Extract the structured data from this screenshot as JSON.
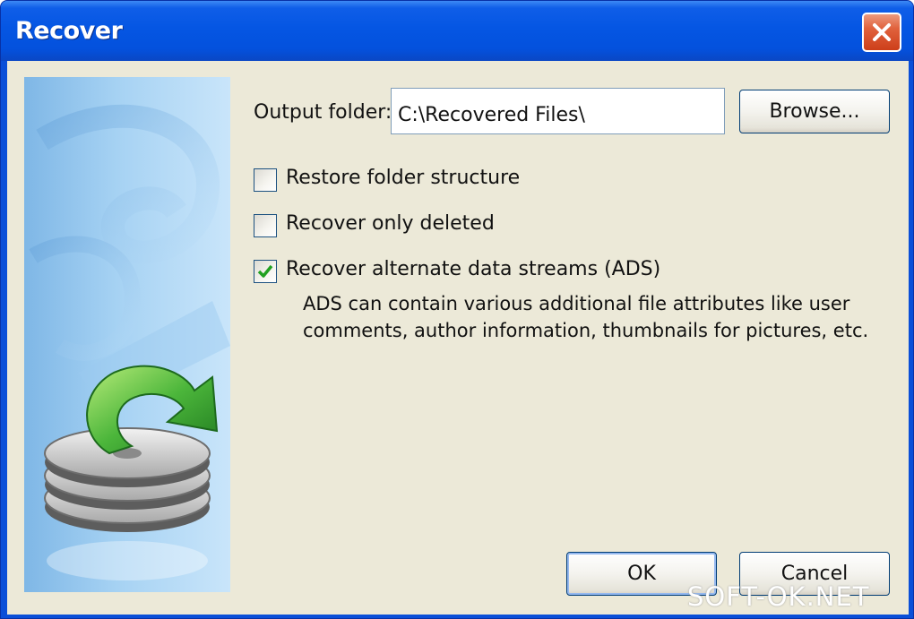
{
  "window": {
    "title": "Recover",
    "close_icon": "close-icon"
  },
  "form": {
    "output_folder_label": "Output folder:",
    "output_folder_value": "C:\\Recovered Files\\",
    "browse_label": "Browse...",
    "options": [
      {
        "label": "Restore folder structure",
        "checked": false
      },
      {
        "label": "Recover only deleted",
        "checked": false
      },
      {
        "label": "Recover alternate data streams (ADS)",
        "checked": true
      }
    ],
    "ads_description_line1": "ADS can contain various additional file attributes like user",
    "ads_description_line2": "comments, author information, thumbnails for pictures, etc."
  },
  "buttons": {
    "ok_label": "OK",
    "cancel_label": "Cancel"
  },
  "side_panel": {
    "icon": "recover-disks-icon"
  },
  "watermark": {
    "text": "SOFT-OK.NET"
  },
  "colors": {
    "titlebar": "#0556e3",
    "dialog_bg": "#ece9d8",
    "close_button": "#e0613c",
    "check_mark": "#21a121",
    "arrow_green": "#3fa635"
  }
}
